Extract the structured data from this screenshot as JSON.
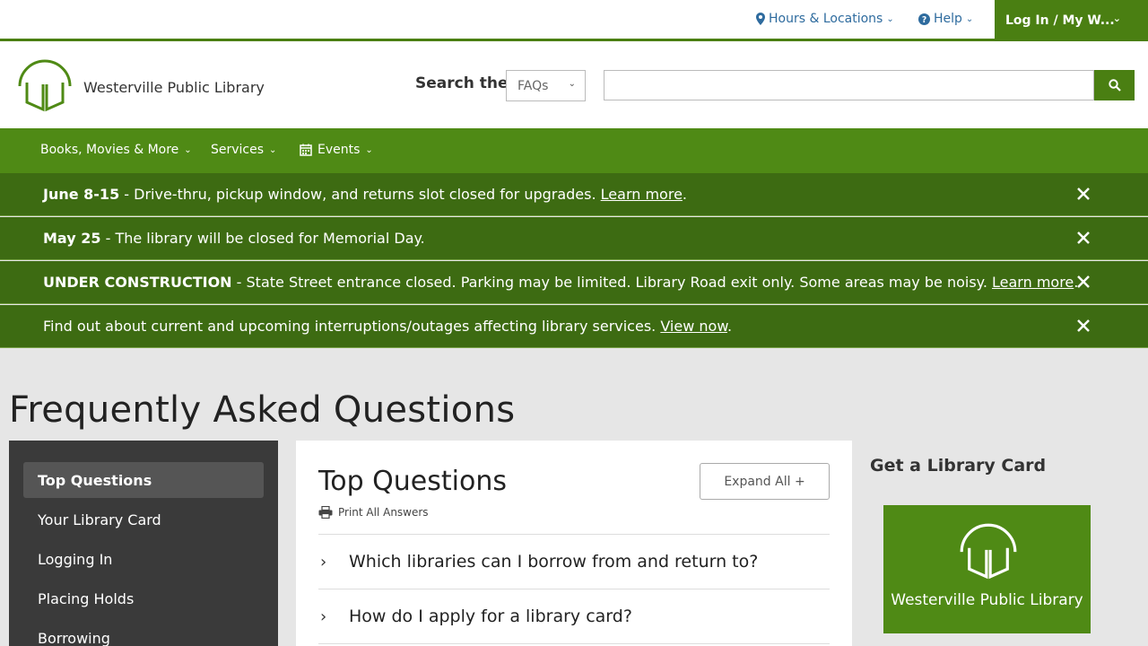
{
  "topbar": {
    "hours": "Hours & Locations",
    "help": "Help",
    "login": "Log In / My W..."
  },
  "header": {
    "logo_text": "Westerville Public Library",
    "search_label": "Search the",
    "search_scope": "FAQs",
    "search_value": ""
  },
  "nav": {
    "items": [
      {
        "label": "Books, Movies & More"
      },
      {
        "label": "Services"
      },
      {
        "label": "Events"
      }
    ]
  },
  "alerts": [
    {
      "bold": "June 8-15",
      "text": " - Drive-thru, pickup window, and returns slot closed for upgrades. ",
      "link": "Learn more",
      "tail": "."
    },
    {
      "bold": "May 25",
      "text": " - The library will be closed for Memorial Day.",
      "link": "",
      "tail": ""
    },
    {
      "bold": "UNDER CONSTRUCTION",
      "text": " - State Street entrance closed. Parking may be limited. Library Road exit only. Some areas may be noisy. ",
      "link": "Learn more",
      "tail": "."
    },
    {
      "bold": "",
      "text": "Find out about current and upcoming interruptions/outages affecting library services. ",
      "link": "View now",
      "tail": "."
    }
  ],
  "page": {
    "title": "Frequently Asked Questions"
  },
  "sidebar": {
    "items": [
      {
        "label": "Top Questions"
      },
      {
        "label": "Your Library Card"
      },
      {
        "label": "Logging In"
      },
      {
        "label": "Placing Holds"
      },
      {
        "label": "Borrowing"
      }
    ]
  },
  "panel": {
    "title": "Top Questions",
    "print": "Print All Answers",
    "expand": "Expand All +",
    "questions": [
      {
        "text": "Which libraries can I borrow from and return to?"
      },
      {
        "text": "How do I apply for a library card?"
      }
    ]
  },
  "right": {
    "title": "Get a Library Card",
    "card_text": "Westerville Public Library"
  },
  "colors": {
    "brand_green": "#4f8a15",
    "alert_green": "#3d6b12",
    "link_blue": "#2e6b9e"
  }
}
